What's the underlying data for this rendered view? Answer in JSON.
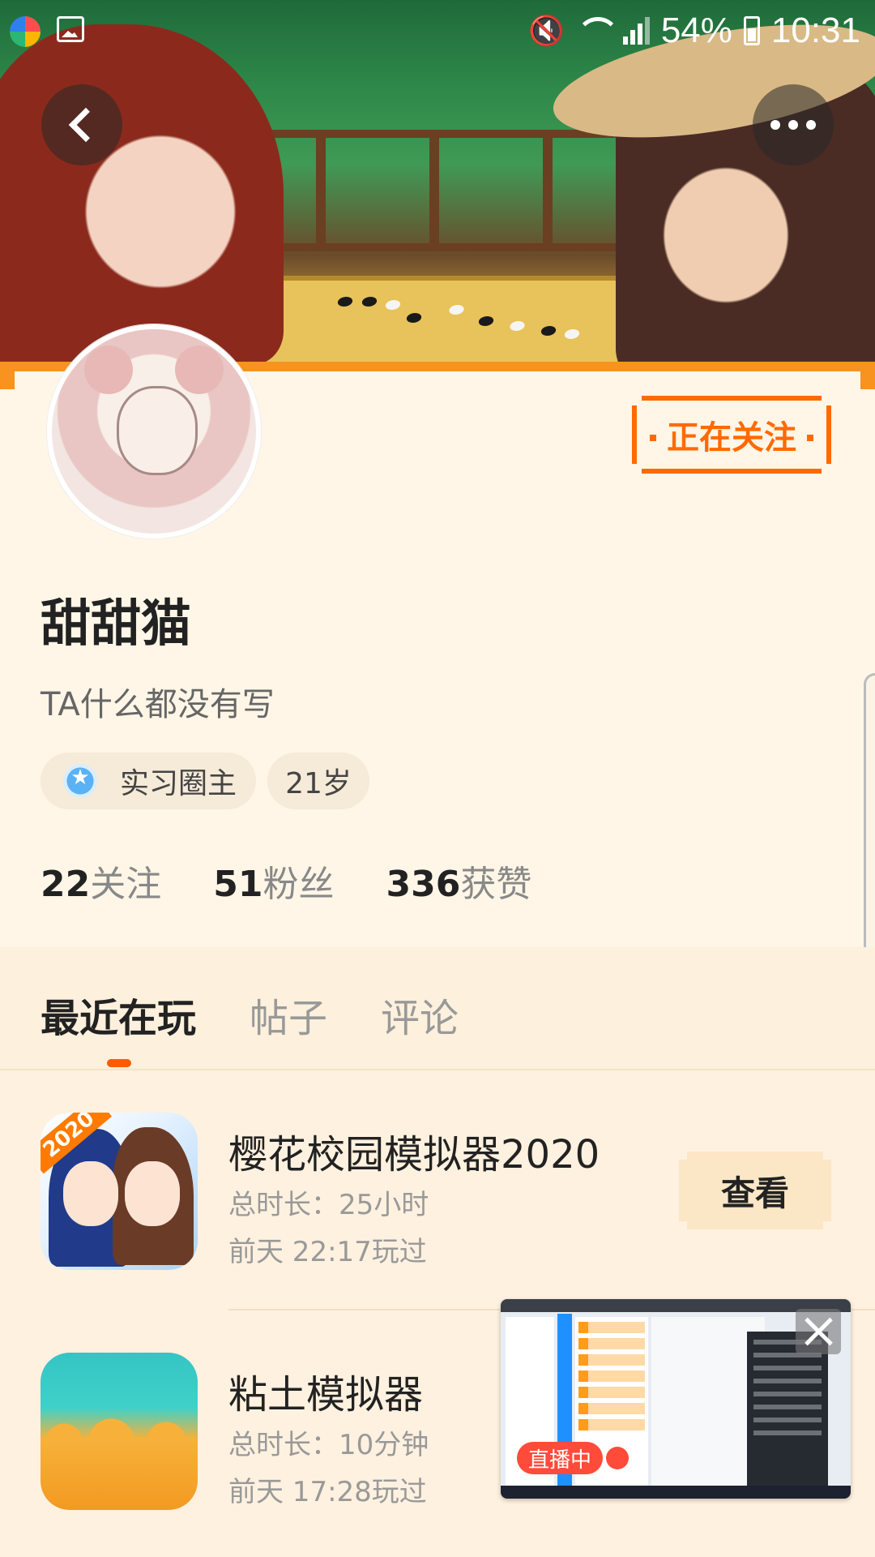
{
  "status_bar": {
    "battery": "54%",
    "time": "10:31"
  },
  "profile": {
    "follow_button": "正在关注",
    "name": "甜甜猫",
    "bio": "TA什么都没有写",
    "tags": {
      "role": "实习圈主",
      "age": "21岁"
    },
    "stats": [
      {
        "num": "22",
        "label": "关注"
      },
      {
        "num": "51",
        "label": "粉丝"
      },
      {
        "num": "336",
        "label": "获赞"
      }
    ]
  },
  "tabs": [
    {
      "label": "最近在玩",
      "active": true
    },
    {
      "label": "帖子",
      "active": false
    },
    {
      "label": "评论",
      "active": false
    }
  ],
  "games": [
    {
      "title": "樱花校园模拟器2020",
      "duration": "总时长：25小时",
      "last_played": "前天 22:17玩过",
      "badge": "2020",
      "button": "查看"
    },
    {
      "title": "粘土模拟器",
      "duration": "总时长：10分钟",
      "last_played": "前天 17:28玩过"
    }
  ],
  "live_overlay": {
    "badge": "直播中"
  }
}
